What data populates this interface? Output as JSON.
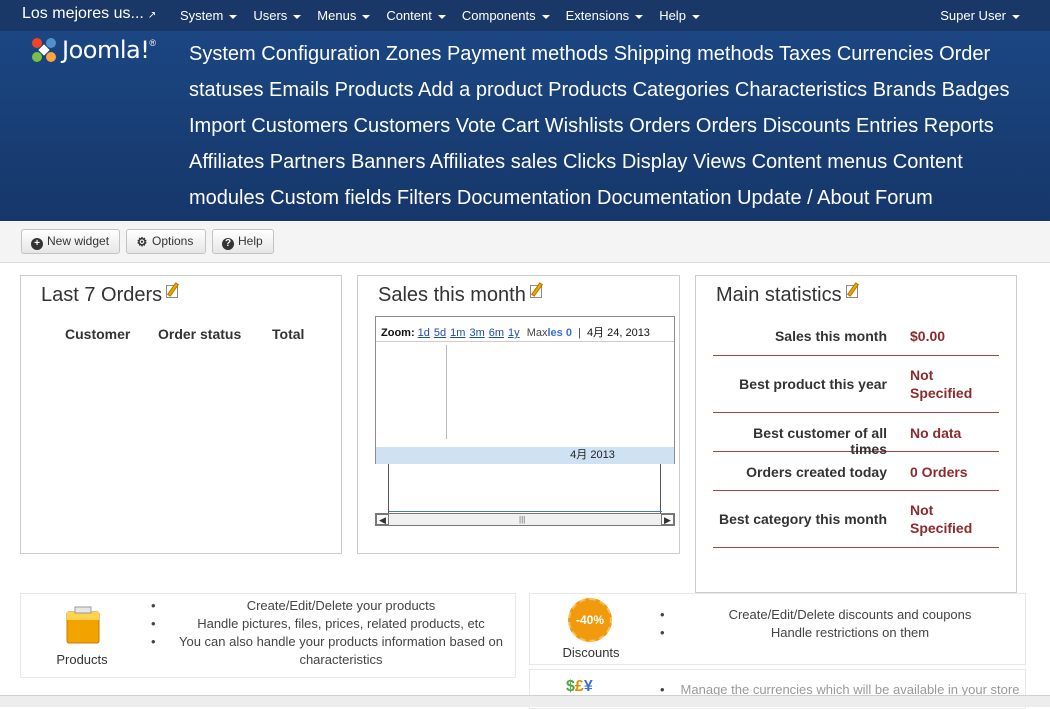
{
  "navbar": {
    "site_title": "Los mejores us...",
    "external_icon": "external-link-icon",
    "menu": [
      "System",
      "Users",
      "Menus",
      "Content",
      "Components",
      "Extensions",
      "Help"
    ],
    "user": "Super User"
  },
  "header": {
    "logo_text": "Joomla!",
    "links": [
      "System",
      "Configuration",
      "Zones",
      "Payment methods",
      "Shipping methods",
      "Taxes",
      "Currencies",
      "Order statuses",
      "Emails",
      "Products",
      "Add a product",
      "Products",
      "Categories",
      "Characteristics",
      "Brands",
      "Badges",
      "Import",
      "Customers",
      "Customers",
      "Vote",
      "Cart",
      "Wishlists",
      "Orders",
      "Orders",
      "Discounts",
      "Entries",
      "Reports",
      "Affiliates",
      "Partners",
      "Banners",
      "Affiliates sales",
      "Clicks",
      "Display",
      "Views",
      "Content",
      "menus",
      "Content",
      "modules",
      "Custom fields",
      "Filters",
      "Documentation",
      "Documentation",
      "Update / About",
      "Forum"
    ]
  },
  "toolbar": {
    "new_widget": "New widget",
    "options": "Options",
    "help": "Help"
  },
  "last_orders": {
    "title": "Last 7 Orders",
    "columns": [
      "Customer",
      "Order status",
      "Total"
    ]
  },
  "sales": {
    "title": "Sales this month",
    "zoom_label": "Zoom:",
    "zoom_options": [
      "1d",
      "5d",
      "1m",
      "3m",
      "6m",
      "1y"
    ],
    "max_label": "Max",
    "max_value": "les 0",
    "date": "4月 24, 2013",
    "month": "4月 2013"
  },
  "main_stats": {
    "title": "Main statistics",
    "rows": [
      {
        "label": "Sales this month",
        "value": "$0.00"
      },
      {
        "label": "Best product this year",
        "value": "Not Specified"
      },
      {
        "label": "Best customer of all times",
        "value": "No data"
      },
      {
        "label": "Orders created today",
        "value": "0 Orders"
      },
      {
        "label": "Best category this month",
        "value": "Not Specified"
      }
    ]
  },
  "features": {
    "products": {
      "name": "Products",
      "icon": "box-icon",
      "items": [
        "Create/Edit/Delete your products",
        "Handle pictures, files, prices, related products, etc",
        "You can also handle your products information based on characteristics"
      ]
    },
    "discounts": {
      "name": "Discounts",
      "icon": "discount-badge-icon",
      "badge": "-40%",
      "items": [
        "Create/Edit/Delete discounts and coupons",
        "Handle restrictions on them"
      ]
    },
    "currencies": {
      "icon": "currency-icon",
      "items": [
        "Manage the currencies which will be available in your store"
      ]
    }
  },
  "colors": {
    "navbar": "#1a3867",
    "header": "#1b4682",
    "stat_value": "#8b2b2b"
  }
}
